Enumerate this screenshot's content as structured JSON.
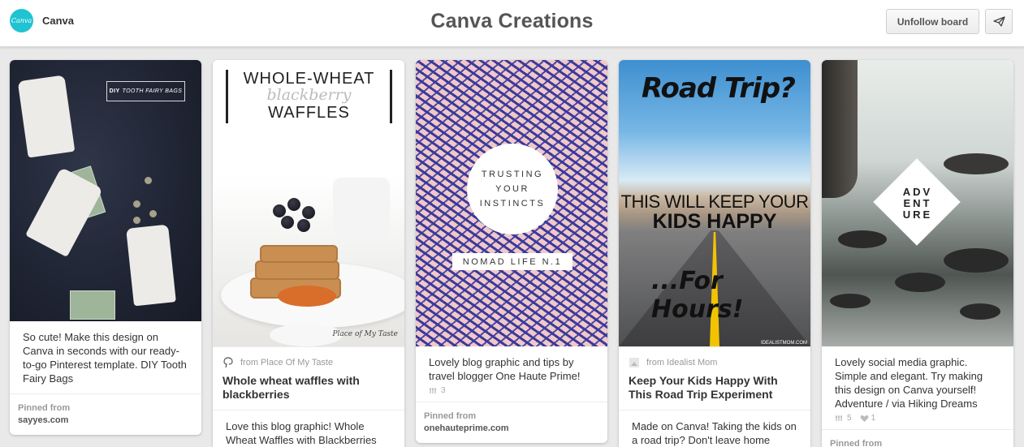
{
  "header": {
    "brand_logo_text": "Canva",
    "brand_name": "Canva",
    "board_title": "Canva Creations",
    "unfollow_label": "Unfollow board",
    "send_icon": "send-icon"
  },
  "colors": {
    "brand": "#1fc3d1",
    "background": "#e9e9e9"
  },
  "pins": [
    {
      "image_tag_bold": "DIY",
      "image_tag_italic": "TOOTH FAIRY BAGS",
      "description": "So cute! Make this design on Canva in seconds with our ready-to-go Pinterest template. DIY Tooth Fairy Bags",
      "pinned_from_label": "Pinned from",
      "pinned_from_domain": "sayyes.com"
    },
    {
      "image_title_top": "WHOLE-WHEAT",
      "image_title_script": "blackberry",
      "image_title_bottom": "WAFFLES",
      "image_watermark": "Place of My Taste",
      "source": "from Place Of My Taste",
      "title": "Whole wheat waffles with blackberries",
      "description": "Love this blog graphic! Whole Wheat Waffles with Blackberries"
    },
    {
      "image_circle_lines": [
        "TRUSTING",
        "YOUR",
        "INSTINCTS"
      ],
      "image_label": "NOMAD LIFE N.1",
      "description": "Lovely blog graphic and tips by travel blogger One Haute Prime!",
      "repins": "3",
      "pinned_from_label": "Pinned from",
      "pinned_from_domain": "onehauteprime.com"
    },
    {
      "image_title": "Road Trip?",
      "image_line1": "THIS WILL KEEP YOUR",
      "image_line2": "KIDS HAPPY",
      "image_line3": "...For Hours!",
      "image_watermark": "IDEALISTMOM.COM",
      "source": "from Idealist Mom",
      "title": "Keep Your Kids Happy With This Road Trip Experiment",
      "description": "Made on Canva! Taking the kids on a road trip? Don't leave home"
    },
    {
      "image_lines": [
        "ADV",
        "ENT",
        "URE"
      ],
      "description": "Lovely social media graphic. Simple and elegant. Try making this design on Canva yourself! Adventure / via Hiking Dreams",
      "repins": "5",
      "likes": "1",
      "pinned_from_label": "Pinned from"
    }
  ]
}
